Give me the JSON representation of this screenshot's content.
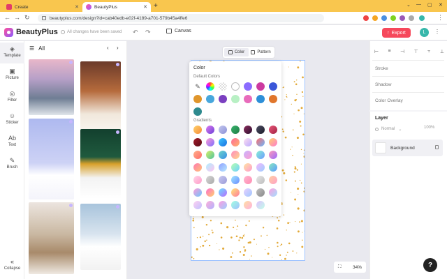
{
  "browser": {
    "tabs": [
      {
        "label": "Create"
      },
      {
        "label": "BeautyPlus"
      }
    ],
    "url": "beautyplus.com/design?id=cab40edb-e02f-4189-a701-579b45a4ffe6"
  },
  "app": {
    "brand": "BeautyPlus",
    "save_status": "All changes have been saved",
    "canvas_label": "Canvas",
    "export_label": "Export",
    "avatar_initial": "L"
  },
  "rail": {
    "items": [
      {
        "label": "Template",
        "icon": "template-icon"
      },
      {
        "label": "Picture",
        "icon": "picture-icon"
      },
      {
        "label": "Filter",
        "icon": "filter-icon"
      },
      {
        "label": "Sticker",
        "icon": "sticker-icon"
      },
      {
        "label": "Text",
        "icon": "text-icon"
      },
      {
        "label": "Brush",
        "icon": "brush-icon"
      }
    ],
    "collapse_label": "Collapse"
  },
  "templates": {
    "header": "All"
  },
  "canvas": {
    "mode_tabs": [
      {
        "label": "Color"
      },
      {
        "label": "Pattern"
      }
    ],
    "zoom": "34%",
    "dot_color": "#e2aa3a"
  },
  "color_popover": {
    "title": "Color",
    "default_label": "Default Colors",
    "gradients_label": "Gradients",
    "default_colors": [
      "#8b6cff",
      "#cc3aa0",
      "#3a56d8",
      "#e0962c",
      "#47a7dc",
      "#7b3fc0",
      "#b8f0c4",
      "#e86bbb",
      "#2d8fd8",
      "#e0762c",
      "#2e8a8e"
    ],
    "gradients": [
      [
        "#ffd36b",
        "#f58a3a"
      ],
      [
        "#e07cf0",
        "#6a3fd6"
      ],
      [
        "#c4c8ee",
        "#8c91d8"
      ],
      [
        "#38b56c",
        "#1e7a46"
      ],
      [
        "#8c2c5c",
        "#2c1030"
      ],
      [
        "#4e4e66",
        "#1c1c28"
      ],
      [
        "#e9577a",
        "#a22343"
      ],
      [
        "#a21a28",
        "#5a0c18"
      ],
      [
        "#ff9bd4",
        "#7c6cff"
      ],
      [
        "#3ec9ff",
        "#1a6fe0"
      ],
      [
        "#ff6b9a",
        "#ffb36b"
      ],
      [
        "#ffe0f0",
        "#b8a8ff"
      ],
      [
        "#ff6b6b",
        "#6bb8ff"
      ],
      [
        "#ffd46b",
        "#ff7ad0"
      ],
      [
        "#ffb089",
        "#ff6b6b"
      ],
      [
        "#d8f06b",
        "#4cc39c"
      ],
      [
        "#6bd6c8",
        "#3a8ee8"
      ],
      [
        "#ff8ac0",
        "#ffd88a"
      ],
      [
        "#c8b4ff",
        "#ff9ccf"
      ],
      [
        "#89f0d4",
        "#6b9cff"
      ],
      [
        "#ff9bb8",
        "#9b6bff"
      ],
      [
        "#ff7ab0",
        "#ffc27a"
      ],
      [
        "#b1f0ff",
        "#ffc3f0"
      ],
      [
        "#8fa0ff",
        "#b8e8ff"
      ],
      [
        "#b8ffb0",
        "#6bd0ff"
      ],
      [
        "#ffe4a0",
        "#ff9bd0"
      ],
      [
        "#f4b8ff",
        "#9ccfff"
      ],
      [
        "#8ae8c0",
        "#5a9cff"
      ],
      [
        "#ffd6e8",
        "#ff9bc8"
      ],
      [
        "#d8d8d8",
        "#a8a8a8"
      ],
      [
        "#c8c8f0",
        "#9b9bd8"
      ],
      [
        "#a0e8ff",
        "#6b8cff"
      ],
      [
        "#ffb8d0",
        "#ff8ab0"
      ],
      [
        "#e8e8e8",
        "#bcbcbc"
      ],
      [
        "#ffd0a0",
        "#ffa0c8"
      ],
      [
        "#ff9ad8",
        "#6bc8ff"
      ],
      [
        "#ff6bd0",
        "#ffd26b"
      ],
      [
        "#6be0ff",
        "#b86bff"
      ],
      [
        "#ffe87a",
        "#ff7a9c"
      ],
      [
        "#e8d0ff",
        "#a0c8ff"
      ],
      [
        "#c0c0c0",
        "#8a8a8a"
      ],
      [
        "#ffa0e0",
        "#a0e0ff"
      ],
      [
        "#ffd0f0",
        "#c0c0ff"
      ],
      [
        "#ffb0d8",
        "#b0b0ff"
      ],
      [
        "#ff9be0",
        "#9bd0ff"
      ],
      [
        "#a0ffe0",
        "#a0c0ff"
      ],
      [
        "#ffe0a0",
        "#ffb0e0"
      ],
      [
        "#e0c0ff",
        "#c0ffe8"
      ]
    ]
  },
  "properties": {
    "stroke_label": "Stroke",
    "shadow_label": "Shadow",
    "color_overlay_label": "Color Overlay",
    "layer_label": "Layer",
    "blend_mode": "Normal",
    "opacity": "100%",
    "layers": [
      {
        "label": "Background"
      }
    ]
  }
}
